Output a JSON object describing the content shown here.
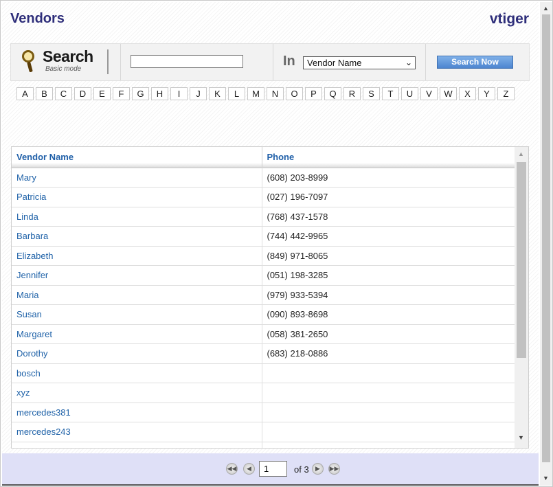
{
  "header": {
    "title": "Vendors",
    "brand": "vtiger"
  },
  "search": {
    "logo_word": "Search",
    "logo_mode": "Basic mode",
    "input_value": "",
    "in_label": "In",
    "field_selected": "Vendor Name",
    "button_label": "Search Now"
  },
  "alphabet": [
    "A",
    "B",
    "C",
    "D",
    "E",
    "F",
    "G",
    "H",
    "I",
    "J",
    "K",
    "L",
    "M",
    "N",
    "O",
    "P",
    "Q",
    "R",
    "S",
    "T",
    "U",
    "V",
    "W",
    "X",
    "Y",
    "Z"
  ],
  "table": {
    "columns": [
      "Vendor Name",
      "Phone"
    ],
    "rows": [
      {
        "name": "Mary",
        "phone": "(608) 203-8999"
      },
      {
        "name": "Patricia",
        "phone": "(027) 196-7097"
      },
      {
        "name": "Linda",
        "phone": "(768) 437-1578"
      },
      {
        "name": "Barbara",
        "phone": "(744) 442-9965"
      },
      {
        "name": "Elizabeth",
        "phone": "(849) 971-8065"
      },
      {
        "name": "Jennifer",
        "phone": "(051) 198-3285"
      },
      {
        "name": "Maria",
        "phone": "(979) 933-5394"
      },
      {
        "name": "Susan",
        "phone": "(090) 893-8698"
      },
      {
        "name": "Margaret",
        "phone": "(058) 381-2650"
      },
      {
        "name": "Dorothy",
        "phone": "(683) 218-0886"
      },
      {
        "name": "bosch",
        "phone": ""
      },
      {
        "name": "xyz",
        "phone": ""
      },
      {
        "name": "mercedes381",
        "phone": ""
      },
      {
        "name": "mercedes243",
        "phone": ""
      },
      {
        "name": "",
        "phone": ""
      }
    ]
  },
  "pager": {
    "current_page": "1",
    "of_label": "of 3"
  },
  "icons": {
    "first": "first-page-icon",
    "prev": "previous-page-icon",
    "next": "next-page-icon",
    "last": "last-page-icon",
    "search": "magnifier-icon"
  },
  "colors": {
    "title": "#2e2e7a",
    "link": "#1f62a8",
    "pager_bg": "#dfe0f7",
    "button": "#4d85d0"
  }
}
